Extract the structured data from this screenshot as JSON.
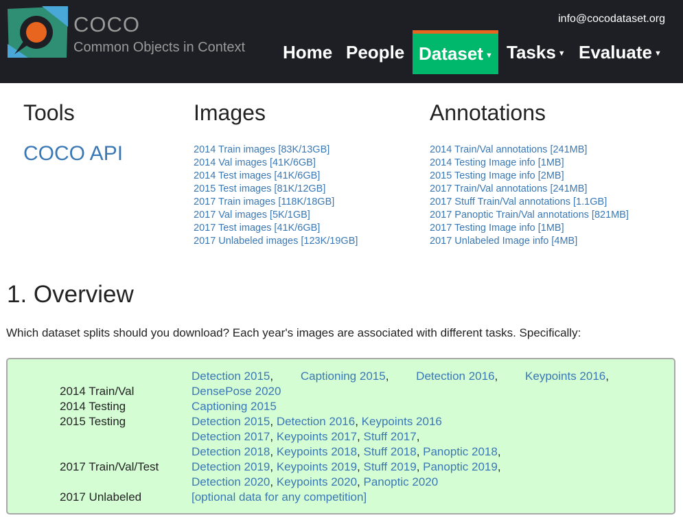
{
  "header": {
    "logo_title": "COCO",
    "logo_subtitle": "Common Objects in Context",
    "email": "info@cocodataset.org",
    "nav": {
      "home": "Home",
      "people": "People",
      "dataset": "Dataset",
      "tasks": "Tasks",
      "evaluate": "Evaluate"
    },
    "colors": {
      "background": "#1e1f24",
      "active_tab": "#00b86b",
      "active_tab_border": "#e8651f"
    }
  },
  "tools": {
    "heading": "Tools",
    "api": "COCO API"
  },
  "images": {
    "heading": "Images",
    "links": [
      "2014 Train images [83K/13GB]",
      "2014 Val images [41K/6GB]",
      "2014 Test images [41K/6GB]",
      "2015 Test images [81K/12GB]",
      "2017 Train images [118K/18GB]",
      "2017 Val images [5K/1GB]",
      "2017 Test images [41K/6GB]",
      "2017 Unlabeled images [123K/19GB]"
    ]
  },
  "annotations": {
    "heading": "Annotations",
    "links": [
      "2014 Train/Val annotations [241MB]",
      "2014 Testing Image info [1MB]",
      "2015 Testing Image info [2MB]",
      "2017 Train/Val annotations [241MB]",
      "2017 Stuff Train/Val annotations [1.1GB]",
      "2017 Panoptic Train/Val annotations [821MB]",
      "2017 Testing Image info [1MB]",
      "2017 Unlabeled Image info [4MB]"
    ]
  },
  "overview": {
    "title": "1. Overview",
    "intro": "Which dataset splits should you download? Each year's images are associated with different tasks. Specifically:",
    "splits": {
      "train_val_2014": "2014 Train/Val",
      "testing_2014": "2014 Testing",
      "testing_2015": "2015 Testing",
      "train_val_test_2017": "2017 Train/Val/Test",
      "unlabeled_2017": "2017 Unlabeled"
    },
    "tasks": {
      "detection_2015": "Detection 2015",
      "captioning_2015": "Captioning 2015",
      "detection_2016": "Detection 2016",
      "keypoints_2016": "Keypoints 2016",
      "densepose_2020": "DensePose 2020",
      "detection_2017": "Detection 2017",
      "keypoints_2017": "Keypoints 2017",
      "stuff_2017": "Stuff 2017",
      "detection_2018": "Detection 2018",
      "keypoints_2018": "Keypoints 2018",
      "stuff_2018": "Stuff 2018",
      "panoptic_2018": "Panoptic 2018",
      "detection_2019": "Detection 2019",
      "keypoints_2019": "Keypoints 2019",
      "stuff_2019": "Stuff 2019",
      "panoptic_2019": "Panoptic 2019",
      "detection_2020": "Detection 2020",
      "keypoints_2020": "Keypoints 2020",
      "panoptic_2020": "Panoptic 2020",
      "optional": "[optional data for any competition]"
    },
    "colors": {
      "box_background": "#d4fdd4",
      "link": "#3a78b5"
    }
  }
}
